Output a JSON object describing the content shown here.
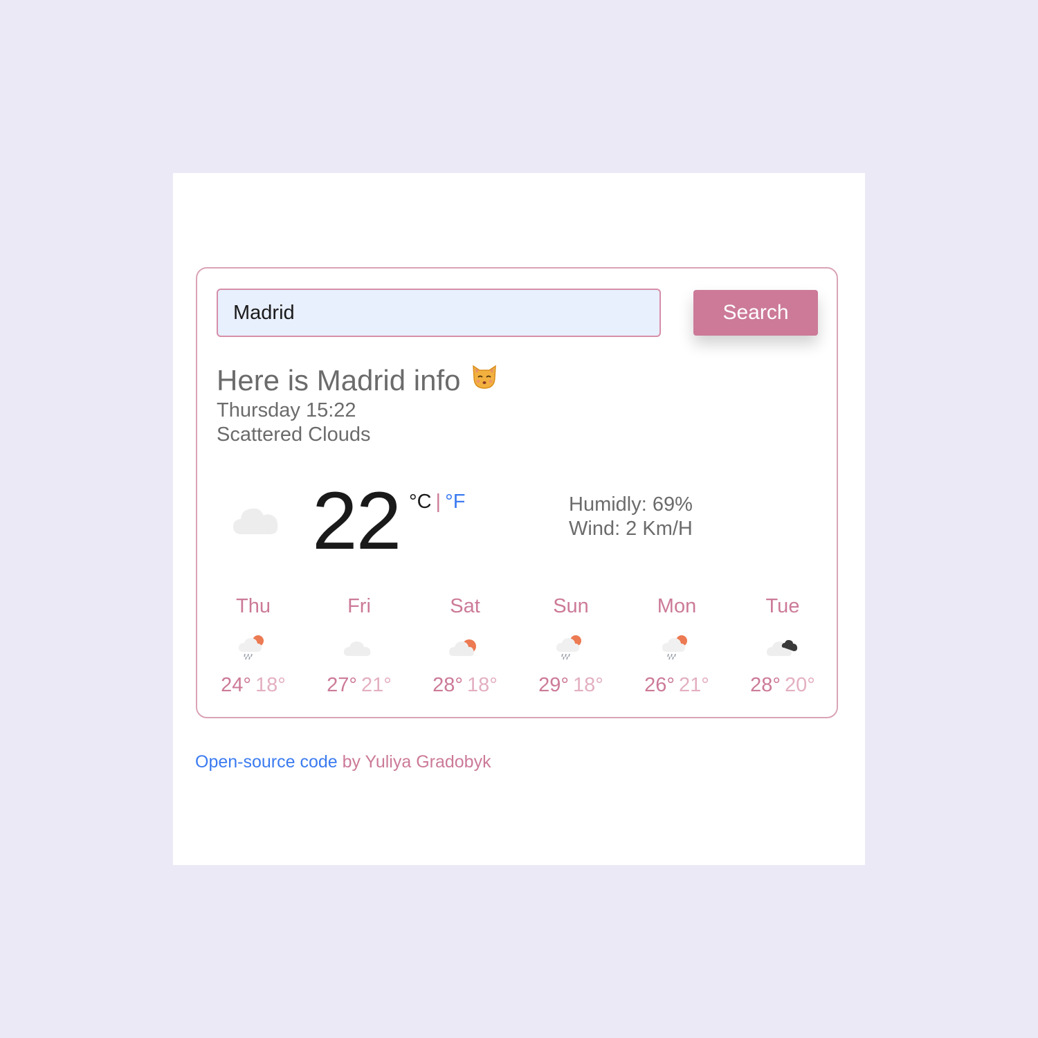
{
  "search": {
    "value": "Madrid",
    "button_label": "Search"
  },
  "current": {
    "heading": "Here is Madrid info",
    "heading_emoji": "kissing-cat-face-icon",
    "datetime": "Thursday 15:22",
    "description": "Scattered Clouds",
    "icon": "cloud-icon",
    "temperature": "22",
    "unit_celsius": "°C",
    "unit_separator": "|",
    "unit_fahrenheit": "°F",
    "humidity": "Humidly: 69%",
    "wind": "Wind: 2 Km/H"
  },
  "forecast": [
    {
      "day": "Thu",
      "icon": "rain-sun-cloud-icon",
      "max": "24°",
      "min": "18°"
    },
    {
      "day": "Fri",
      "icon": "cloud-icon",
      "max": "27°",
      "min": "21°"
    },
    {
      "day": "Sat",
      "icon": "sun-behind-cloud-icon",
      "max": "28°",
      "min": "18°"
    },
    {
      "day": "Sun",
      "icon": "rain-sun-cloud-icon",
      "max": "29°",
      "min": "18°"
    },
    {
      "day": "Mon",
      "icon": "rain-sun-cloud-icon",
      "max": "26°",
      "min": "21°"
    },
    {
      "day": "Tue",
      "icon": "dark-cloud-icon",
      "max": "28°",
      "min": "20°"
    }
  ],
  "footer": {
    "link_text": "Open-source code",
    "by_text": "by Yuliya Gradobyk"
  },
  "colors": {
    "accent": "#cc7a98",
    "link": "#3b7bf0",
    "background": "#ece9f7",
    "input_bg": "#e8effd"
  }
}
